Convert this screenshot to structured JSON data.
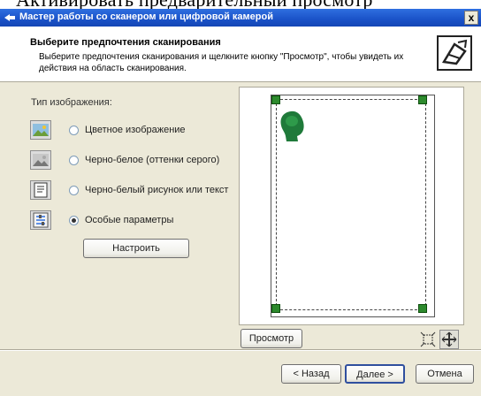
{
  "fragment_text": "Активировать предварительный просмотр",
  "window": {
    "title": "Мастер работы со сканером или цифровой камерой",
    "close_glyph": "x"
  },
  "header": {
    "title": "Выберите предпочтения сканирования",
    "subtitle": "Выберите предпочтения сканирования и щелкните кнопку \"Просмотр\", чтобы увидеть их действия на область сканирования.",
    "icon": "scanner-wizard-icon"
  },
  "image_type": {
    "label": "Тип изображения:",
    "options": [
      {
        "label": "Цветное изображение",
        "icon": "color-picture-icon",
        "selected": false
      },
      {
        "label": "Черно-белое (оттенки серого)",
        "icon": "grayscale-picture-icon",
        "selected": false
      },
      {
        "label": "Черно-белый рисунок или текст",
        "icon": "bw-text-icon",
        "selected": false
      },
      {
        "label": "Особые параметры",
        "icon": "custom-settings-icon",
        "selected": true
      }
    ],
    "configure_label": "Настроить"
  },
  "preview": {
    "button_label": "Просмотр",
    "tools": [
      "crop-to-selection-icon",
      "zoom-icon"
    ]
  },
  "nav": {
    "back_label": "< Назад",
    "next_label": "Далее >",
    "cancel_label": "Отмена"
  },
  "colors": {
    "titlebar": "#1a52c8",
    "handle": "#2d8a2d",
    "face": "#ece9d8"
  }
}
